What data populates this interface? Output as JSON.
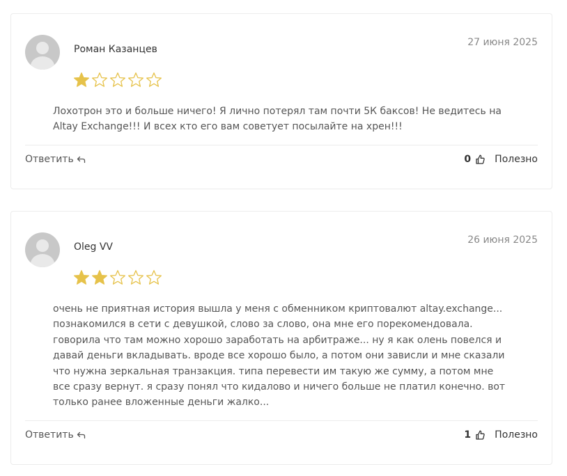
{
  "colors": {
    "star_filled": "#e6c24a",
    "star_empty": "#e6c24a",
    "text_main": "#333333",
    "text_muted": "#888888",
    "border": "#ececec",
    "avatar_bg": "#c8c8c8"
  },
  "icons": {
    "avatar": "user-avatar-placeholder",
    "star": "star-icon",
    "reply": "reply-arrow-icon",
    "like": "thumbs-up-icon"
  },
  "reviews": [
    {
      "author": "Роман Казанцев",
      "date": "27 июня 2025",
      "rating": 1,
      "rating_max": 5,
      "text": "Лохотрон это и больше ничего! Я лично потерял там почти 5К баксов! Не ведитесь на Altay Exchange!!! И всех кто его вам советует посылайте на хрен!!!",
      "reply_label": "Ответить",
      "likes": "0",
      "helpful_label": "Полезно"
    },
    {
      "author": "Oleg VV",
      "date": "26 июня 2025",
      "rating": 2,
      "rating_max": 5,
      "text": "очень не приятная история вышла у меня с обменником криптовалют altay.exchange... познакомился в сети с девушкой, слово за слово, она мне его порекомендовала. говорила что там можно хорошо заработать на арбитраже... ну я как олень повелся и давай деньги вкладывать. вроде все хорошо было, а потом они зависли и мне сказали что нужна зеркальная транзакция. типа перевести им такую же сумму, а потом мне все сразу вернут. я сразу понял что кидалово и ничего больше не платил конечно. вот только ранее вложенные деньги жалко...",
      "reply_label": "Ответить",
      "likes": "1",
      "helpful_label": "Полезно"
    }
  ]
}
